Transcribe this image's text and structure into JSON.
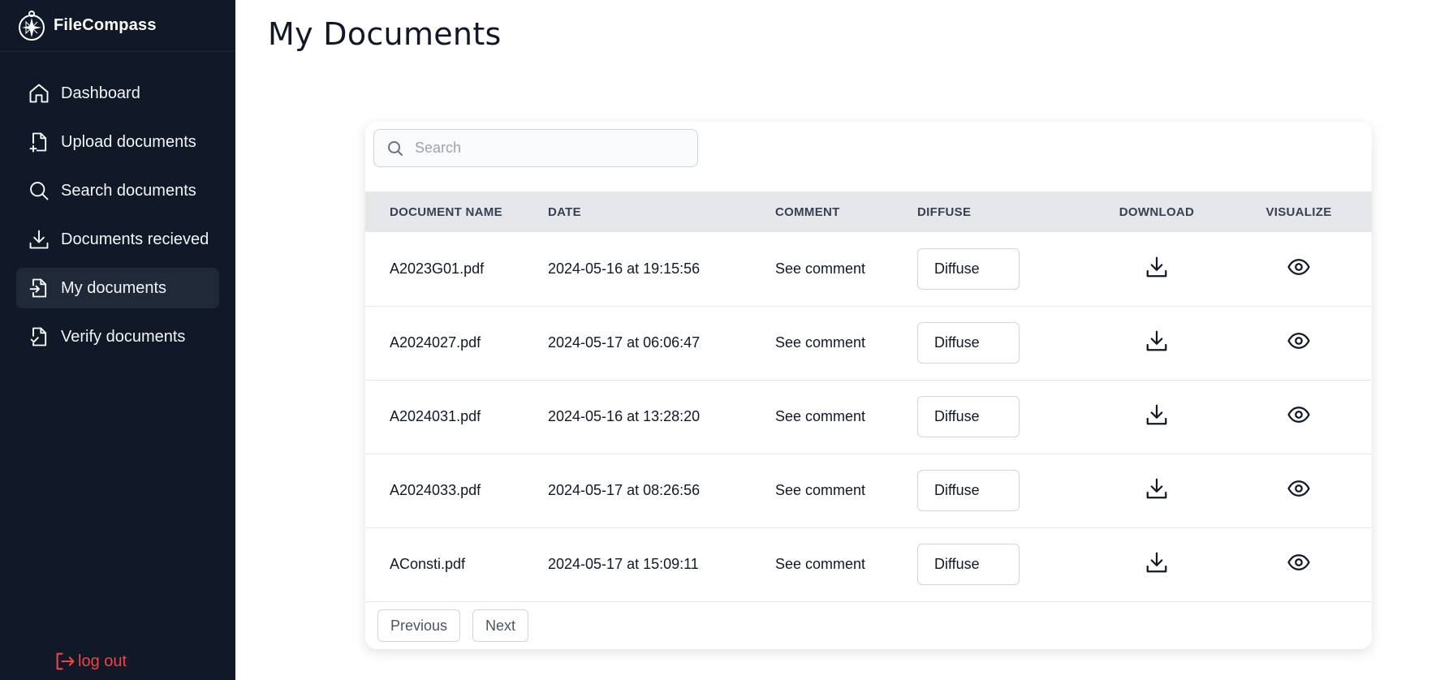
{
  "app": {
    "name": "FileCompass"
  },
  "sidebar": {
    "items": [
      {
        "label": "Dashboard",
        "icon": "home-icon"
      },
      {
        "label": "Upload documents",
        "icon": "file-plus-icon"
      },
      {
        "label": "Search documents",
        "icon": "search-icon"
      },
      {
        "label": "Documents recieved",
        "icon": "download-icon"
      },
      {
        "label": "My documents",
        "icon": "file-import-icon",
        "active": true
      },
      {
        "label": "Verify documents",
        "icon": "file-check-icon"
      }
    ],
    "logout_label": "log out"
  },
  "page": {
    "title": "My Documents"
  },
  "search": {
    "placeholder": "Search",
    "value": ""
  },
  "table": {
    "headers": {
      "name": "DOCUMENT NAME",
      "date": "DATE",
      "comment": "COMMENT",
      "diffuse": "DIFFUSE",
      "download": "DOWNLOAD",
      "visualize": "VISUALIZE"
    },
    "rows": [
      {
        "name": "A2023G01.pdf",
        "date": "2024-05-16 at 19:15:56",
        "comment": "See comment",
        "diffuse": "Diffuse"
      },
      {
        "name": "A2024027.pdf",
        "date": "2024-05-17 at 06:06:47",
        "comment": "See comment",
        "diffuse": "Diffuse"
      },
      {
        "name": "A2024031.pdf",
        "date": "2024-05-16 at 13:28:20",
        "comment": "See comment",
        "diffuse": "Diffuse"
      },
      {
        "name": "A2024033.pdf",
        "date": "2024-05-17 at 08:26:56",
        "comment": "See comment",
        "diffuse": "Diffuse"
      },
      {
        "name": "AConsti.pdf",
        "date": "2024-05-17 at 15:09:11",
        "comment": "See comment",
        "diffuse": "Diffuse"
      }
    ]
  },
  "pagination": {
    "previous_label": "Previous",
    "next_label": "Next"
  },
  "colors": {
    "sidebar_bg": "#111827",
    "sidebar_active": "#1f2937",
    "logout": "#ef4444",
    "table_header_bg": "#e5e7eb"
  }
}
